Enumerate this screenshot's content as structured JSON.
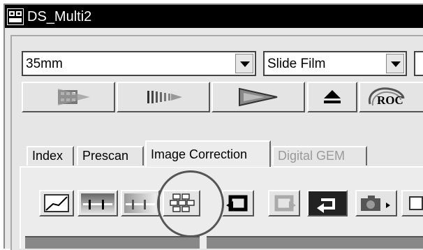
{
  "window": {
    "title": "DS_Multi2"
  },
  "controls": {
    "film_format": "35mm",
    "film_type": "Slide Film"
  },
  "toolbar_buttons": [
    {
      "name": "index-scan-icon"
    },
    {
      "name": "prescan-icon"
    },
    {
      "name": "scan-icon"
    },
    {
      "name": "eject-icon"
    },
    {
      "name": "roc-icon",
      "label": "ROC"
    }
  ],
  "tabs": [
    {
      "label": "Index"
    },
    {
      "label": "Prescan"
    },
    {
      "label": "Image Correction",
      "active": true
    },
    {
      "label": "Digital GEM",
      "disabled": true
    }
  ],
  "correction_tools": [
    {
      "name": "tone-curve-icon"
    },
    {
      "name": "brightness-contrast-icon"
    },
    {
      "name": "color-balance-icon"
    },
    {
      "name": "variations-icon"
    },
    {
      "name": "undo-icon"
    },
    {
      "name": "redo-icon"
    },
    {
      "name": "reset-icon"
    },
    {
      "name": "snapshot-icon"
    }
  ]
}
